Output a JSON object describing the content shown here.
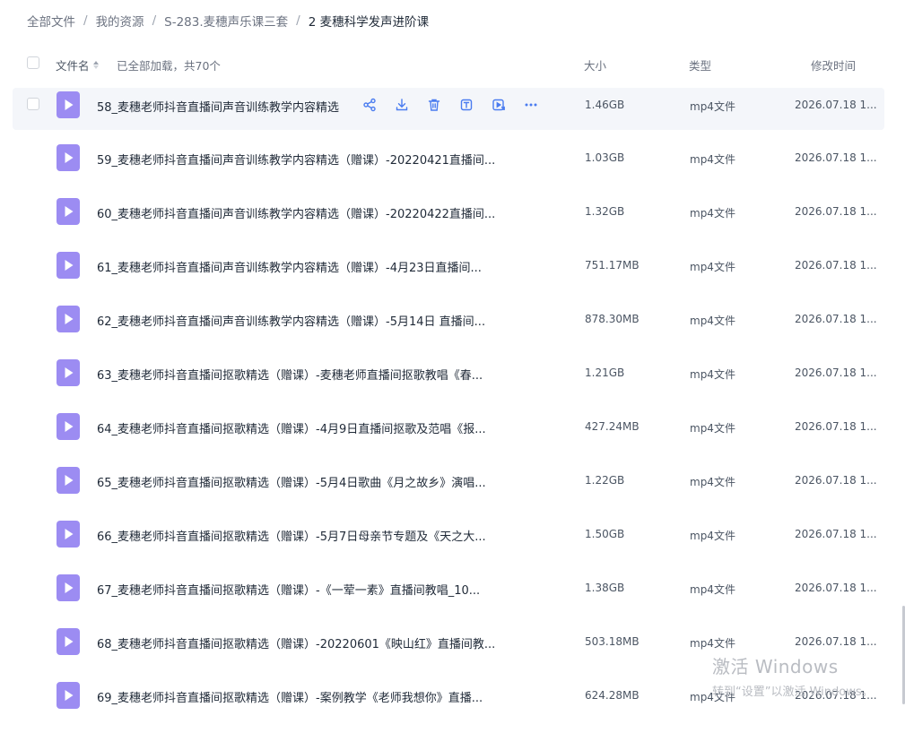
{
  "breadcrumb": {
    "items": [
      "全部文件",
      "我的资源",
      "S-283.麦穗声乐课三套",
      "2 麦穗科学发声进阶课"
    ],
    "separator": "/"
  },
  "header": {
    "name_label": "文件名",
    "loaded_text": "已全部加载，共70个",
    "size_label": "大小",
    "type_label": "类型",
    "time_label": "修改时间"
  },
  "rows": [
    {
      "name": "58_麦穗老师抖音直播间声音训练教学内容精选",
      "size": "1.46GB",
      "type": "mp4文件",
      "time": "2026.07.18 1..."
    },
    {
      "name": "59_麦穗老师抖音直播间声音训练教学内容精选（赠课）-20220421直播间...",
      "size": "1.03GB",
      "type": "mp4文件",
      "time": "2026.07.18 1..."
    },
    {
      "name": "60_麦穗老师抖音直播间声音训练教学内容精选（赠课）-20220422直播间...",
      "size": "1.32GB",
      "type": "mp4文件",
      "time": "2026.07.18 1..."
    },
    {
      "name": "61_麦穗老师抖音直播间声音训练教学内容精选（赠课）-4月23日直播间...",
      "size": "751.17MB",
      "type": "mp4文件",
      "time": "2026.07.18 1..."
    },
    {
      "name": "62_麦穗老师抖音直播间声音训练教学内容精选（赠课）-5月14日 直播间...",
      "size": "878.30MB",
      "type": "mp4文件",
      "time": "2026.07.18 1..."
    },
    {
      "name": "63_麦穗老师抖音直播间抠歌精选（赠课）-麦穗老师直播间抠歌教唱《春...",
      "size": "1.21GB",
      "type": "mp4文件",
      "time": "2026.07.18 1..."
    },
    {
      "name": "64_麦穗老师抖音直播间抠歌精选（赠课）-4月9日直播间抠歌及范唱《报...",
      "size": "427.24MB",
      "type": "mp4文件",
      "time": "2026.07.18 1..."
    },
    {
      "name": "65_麦穗老师抖音直播间抠歌精选（赠课）-5月4日歌曲《月之故乡》演唱...",
      "size": "1.22GB",
      "type": "mp4文件",
      "time": "2026.07.18 1..."
    },
    {
      "name": "66_麦穗老师抖音直播间抠歌精选（赠课）-5月7日母亲节专题及《天之大...",
      "size": "1.50GB",
      "type": "mp4文件",
      "time": "2026.07.18 1..."
    },
    {
      "name": "67_麦穗老师抖音直播间抠歌精选（赠课）-《一荤一素》直播间教唱_10...",
      "size": "1.38GB",
      "type": "mp4文件",
      "time": "2026.07.18 1..."
    },
    {
      "name": "68_麦穗老师抖音直播间抠歌精选（赠课）-20220601《映山红》直播间教...",
      "size": "503.18MB",
      "type": "mp4文件",
      "time": "2026.07.18 1..."
    },
    {
      "name": "69_麦穗老师抖音直播间抠歌精选（赠课）-案例教学《老师我想你》直播...",
      "size": "624.28MB",
      "type": "mp4文件",
      "time": "2026.07.18 1..."
    }
  ],
  "watermark": {
    "title": "激活 Windows",
    "subtitle": "转到“设置”以激活 Windows。"
  },
  "colors": {
    "video_icon": "#9c8cf2",
    "action_icon": "#4a7cf0",
    "hover_row": "#f4f6fa"
  }
}
